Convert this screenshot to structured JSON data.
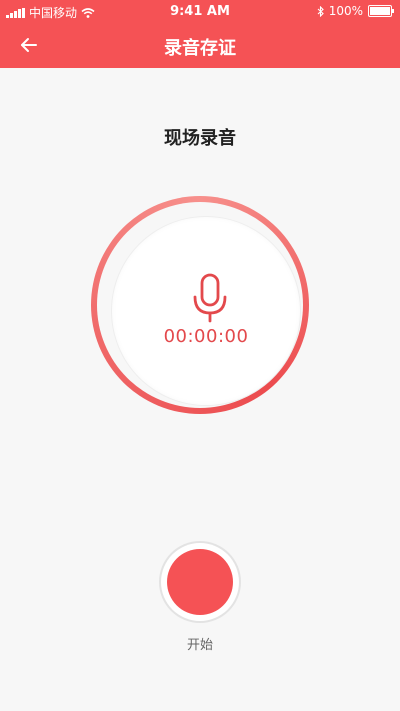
{
  "status_bar": {
    "carrier": "中国移动",
    "time": "9:41 AM",
    "battery": "100%",
    "icons": [
      "signal-icon",
      "wifi-icon",
      "bluetooth-icon",
      "battery-icon"
    ]
  },
  "nav": {
    "title": "录音存证",
    "back_icon": "arrow-left-icon"
  },
  "section": {
    "title": "现场录音"
  },
  "recorder": {
    "timer": "00:00:00",
    "mic_icon": "microphone-icon"
  },
  "controls": {
    "start_label": "开始"
  },
  "colors": {
    "accent": "#f55255",
    "timer_text": "#e3494c",
    "background": "#f7f7f7"
  }
}
